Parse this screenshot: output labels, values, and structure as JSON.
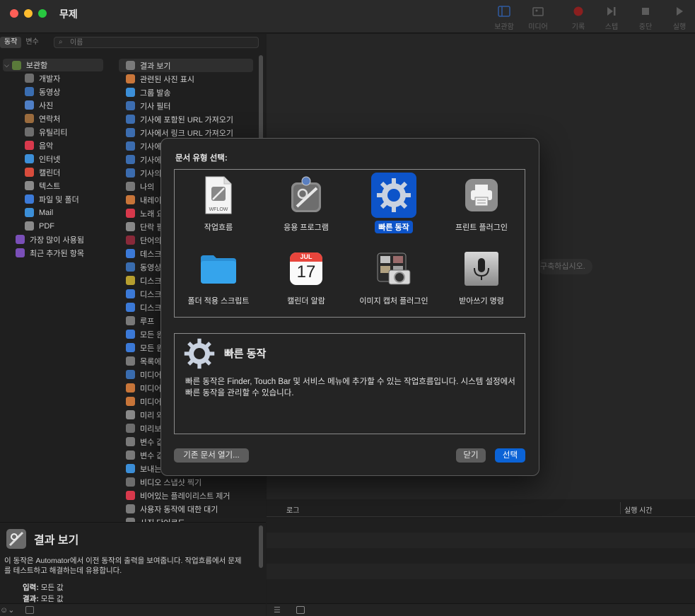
{
  "window": {
    "title": "무제"
  },
  "toolbar": {
    "library": "보관함",
    "media": "미디어",
    "record": "기록",
    "step": "스텝",
    "stop": "중단",
    "run": "실행"
  },
  "left": {
    "tabs": [
      "동작",
      "변수"
    ],
    "search_placeholder": "이름",
    "library_root": "보관함",
    "library_items": [
      {
        "label": "개발자",
        "icon": "developer-icon",
        "color": "#6e6e6e"
      },
      {
        "label": "동영상",
        "icon": "movie-icon",
        "color": "#3a6db0"
      },
      {
        "label": "사진",
        "icon": "photo-icon",
        "color": "#4f7fc6"
      },
      {
        "label": "연락처",
        "icon": "contacts-icon",
        "color": "#9a6b3d"
      },
      {
        "label": "유틸리티",
        "icon": "utility-icon",
        "color": "#6e6e6e"
      },
      {
        "label": "음악",
        "icon": "music-icon",
        "color": "#d8394c"
      },
      {
        "label": "인터넷",
        "icon": "internet-icon",
        "color": "#3c8fd8"
      },
      {
        "label": "캘린더",
        "icon": "calendar-icon",
        "color": "#d84c3c"
      },
      {
        "label": "텍스트",
        "icon": "text-icon",
        "color": "#8a8a8a"
      },
      {
        "label": "파일 및 폴더",
        "icon": "finder-icon",
        "color": "#3c7ad8"
      },
      {
        "label": "Mail",
        "icon": "mail-icon",
        "color": "#3c8fd8"
      },
      {
        "label": "PDF",
        "icon": "pdf-icon",
        "color": "#8a8a8a"
      }
    ],
    "library_top": [
      {
        "label": "가장 많이 사용됨",
        "icon": "smart-folder-icon",
        "color": "#7a4fb8"
      },
      {
        "label": "최근 추가된 항목",
        "icon": "smart-folder-icon",
        "color": "#7a4fb8"
      }
    ],
    "actions": [
      {
        "label": "결과 보기",
        "color": "#7a7a7a"
      },
      {
        "label": "관련된 사진 표시",
        "color": "#c9763a"
      },
      {
        "label": "그룹 발송",
        "color": "#3c8fd8"
      },
      {
        "label": "기사 필터",
        "color": "#3c6db0"
      },
      {
        "label": "기사에 포함된 URL 가져오기",
        "color": "#3c6db0"
      },
      {
        "label": "기사에서 링크 URL 가져오기",
        "color": "#3c6db0"
      },
      {
        "label": "기사에",
        "color": "#3c6db0"
      },
      {
        "label": "기사에",
        "color": "#3c6db0"
      },
      {
        "label": "기사의",
        "color": "#3c6db0"
      },
      {
        "label": "나의 ",
        "color": "#7a7a7a"
      },
      {
        "label": "내레이",
        "color": "#c9763a"
      },
      {
        "label": "노래 요",
        "color": "#d8394c"
      },
      {
        "label": "단락 필",
        "color": "#8a8a8a"
      },
      {
        "label": "단어의",
        "color": "#8a2a3a"
      },
      {
        "label": "데스크",
        "color": "#3c7ad8"
      },
      {
        "label": "동영상",
        "color": "#3a6db0"
      },
      {
        "label": "디스크",
        "color": "#b8a030"
      },
      {
        "label": "디스크",
        "color": "#3c7ad8"
      },
      {
        "label": "디스크",
        "color": "#3c7ad8"
      },
      {
        "label": "루프",
        "color": "#7a7a7a"
      },
      {
        "label": "모든 원",
        "color": "#3c7ad8"
      },
      {
        "label": "모든 원",
        "color": "#3c7ad8"
      },
      {
        "label": "목록에",
        "color": "#7a7a7a"
      },
      {
        "label": "미디어",
        "color": "#3a6db0"
      },
      {
        "label": "미디어",
        "color": "#c9763a"
      },
      {
        "label": "미디어",
        "color": "#c9763a"
      },
      {
        "label": "미리 와",
        "color": "#8a8a8a"
      },
      {
        "label": "미리보",
        "color": "#6e6e6e"
      },
      {
        "label": "변수 값",
        "color": "#7a7a7a"
      },
      {
        "label": "변수 값",
        "color": "#7a7a7a"
      },
      {
        "label": "보내는",
        "color": "#3c8fd8"
      },
      {
        "label": "비디오 스냅샷 찍기",
        "color": "#6e6e6e"
      },
      {
        "label": "비어있는 플레이리스트 제거",
        "color": "#d8394c"
      },
      {
        "label": "사용자 동작에 대한 대기",
        "color": "#7a7a7a"
      },
      {
        "label": "사진 단어로도",
        "color": "#7a7a7a"
      }
    ],
    "description": {
      "title": "결과 보기",
      "text": "이 동작은 Automator에서 이전 동작의 출력을 보여줍니다. 작업흐름에서 문제를 테스트하고 해결하는데 유용합니다.",
      "input_label": "입력:",
      "input_value": "모든 값",
      "result_label": "결과:",
      "result_value": "모든 값"
    }
  },
  "workflow": {
    "hint": "구축하십시오.",
    "log_header": "로그",
    "duration_header": "실행 시간"
  },
  "modal": {
    "title": "문서 유형 선택:",
    "types": [
      {
        "label": "작업흐름",
        "icon": "workflow-document-icon"
      },
      {
        "label": "응용 프로그램",
        "icon": "application-robot-icon"
      },
      {
        "label": "빠른 동작",
        "icon": "gear-icon",
        "selected": true
      },
      {
        "label": "프린트 플러그인",
        "icon": "printer-icon"
      },
      {
        "label": "폴더 적용 스크립트",
        "icon": "folder-icon"
      },
      {
        "label": "캘린더 알람",
        "icon": "calendar-icon"
      },
      {
        "label": "이미지 캡처 플러그인",
        "icon": "image-capture-icon"
      },
      {
        "label": "받아쓰기 명령",
        "icon": "microphone-icon"
      }
    ],
    "calendar_month": "JUL",
    "calendar_day": "17",
    "workflow_doc_label": "WFLOW",
    "info_title": "빠른 동작",
    "info_text": "빠른 동작은 Finder, Touch Bar 및 서비스 메뉴에 추가할 수 있는 작업흐름입니다. 시스템 설정에서 빠른 동작을 관리할 수 있습니다.",
    "open_existing": "기존 문서 열기...",
    "close": "닫기",
    "choose": "선택"
  }
}
